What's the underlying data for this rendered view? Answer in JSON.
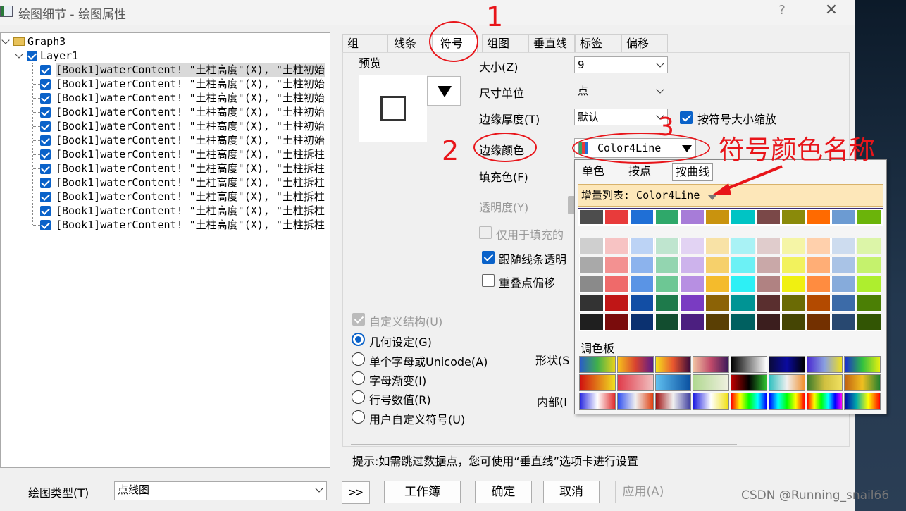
{
  "window": {
    "title": "绘图细节 - 绘图属性",
    "help": "?",
    "close": "✕"
  },
  "tree": {
    "graph": "Graph3",
    "layer": "Layer1",
    "items": [
      "[Book1]waterContent! \"土柱高度\"(X), \"土柱初始",
      "[Book1]waterContent! \"土柱高度\"(X), \"土柱初始",
      "[Book1]waterContent! \"土柱高度\"(X), \"土柱初始",
      "[Book1]waterContent! \"土柱高度\"(X), \"土柱初始",
      "[Book1]waterContent! \"土柱高度\"(X), \"土柱初始",
      "[Book1]waterContent! \"土柱高度\"(X), \"土柱初始",
      "[Book1]waterContent! \"土柱高度\"(X), \"土柱拆柱",
      "[Book1]waterContent! \"土柱高度\"(X), \"土柱拆柱",
      "[Book1]waterContent! \"土柱高度\"(X), \"土柱拆柱",
      "[Book1]waterContent! \"土柱高度\"(X), \"土柱拆柱",
      "[Book1]waterContent! \"土柱高度\"(X), \"土柱拆柱",
      "[Book1]waterContent! \"土柱高度\"(X), \"土柱拆柱"
    ]
  },
  "tabs": [
    "组",
    "线条",
    "符号",
    "组图",
    "垂直线",
    "标签",
    "偏移"
  ],
  "symbol": {
    "preview_label": "预览",
    "size_label": "大小(Z)",
    "size_value": "9",
    "unit_label": "尺寸单位",
    "unit_value": "点",
    "edge_thickness_label": "边缘厚度(T)",
    "edge_thickness_value": "默认",
    "scale_checkbox": "按符号大小缩放",
    "edge_color_label": "边缘颜色",
    "edge_color_value": "Color4Line",
    "fill_color_label": "填充色(F)",
    "transparency_label": "透明度(Y)",
    "fill_only_label": "仅用于填充的",
    "follow_line_label": "跟随线条透明",
    "overlap_label": "重叠点偏移",
    "custom_struct_label": "自定义结构(U)",
    "radios": [
      "几何设定(G)",
      "单个字母或Unicode(A)",
      "字母渐变(I)",
      "行号数值(R)",
      "用户自定义符号(U)"
    ],
    "shape_label": "形状(S",
    "inner_label": "内部(I",
    "hint": "提示:如需跳过数据点，您可使用“垂直线”选项卡进行设置"
  },
  "popup": {
    "tabs": [
      "单色",
      "按点",
      "按曲线"
    ],
    "increment_label": "增量列表: Color4Line",
    "palette_label": "调色板",
    "increment_colors": [
      "#4d4d4d",
      "#e83b3b",
      "#1f6fd6",
      "#2fa86a",
      "#a77cd8",
      "#c9930e",
      "#00c4c4",
      "#7a4848",
      "#8a8a0a",
      "#ff6a00",
      "#6c9bd2",
      "#6bb40a"
    ],
    "shade_rows": [
      [
        "#cfcfcf",
        "#f7c3c3",
        "#bcd3f5",
        "#bfe5cf",
        "#e2d3f3",
        "#f8e2a6",
        "#a9f2f5",
        "#e0cccc",
        "#f5f5a6",
        "#ffd0ac",
        "#cddcef",
        "#dcf5a8"
      ],
      [
        "#a9a9a9",
        "#f39191",
        "#8cb3ed",
        "#93d5b0",
        "#cdb3ec",
        "#f6d06b",
        "#6cf1f5",
        "#c9a8a8",
        "#f2f25d",
        "#ffae76",
        "#a9c3e6",
        "#c5f26d"
      ],
      [
        "#8a8a8a",
        "#ef6a6a",
        "#5a94e5",
        "#6dc794",
        "#b78fe2",
        "#f4bb2c",
        "#2df0f5",
        "#b08282",
        "#f0f011",
        "#ff8c40",
        "#86abdb",
        "#aeee2e"
      ],
      [
        "#333333",
        "#c01616",
        "#124ea5",
        "#1e7a4b",
        "#7a3bc2",
        "#8c6306",
        "#009494",
        "#5a2f2f",
        "#6b6b05",
        "#b34a00",
        "#3c6ba8",
        "#4b7f05"
      ],
      [
        "#1f1f1f",
        "#7a0c0c",
        "#0b3170",
        "#124d2f",
        "#4c1f80",
        "#5a3f04",
        "#006060",
        "#3b1e1e",
        "#454504",
        "#733000",
        "#284870",
        "#325504"
      ]
    ]
  },
  "bottom": {
    "plot_type_label": "绘图类型(T)",
    "plot_type_value": "点线图",
    "expand": ">>",
    "workbook": "工作簿",
    "ok": "确定",
    "cancel": "取消",
    "apply": "应用(A)"
  },
  "annotations": {
    "n1": "1",
    "n2": "2",
    "n3": "3",
    "callout": "符号颜色名称"
  },
  "watermark": "CSDN @Running_snail66"
}
